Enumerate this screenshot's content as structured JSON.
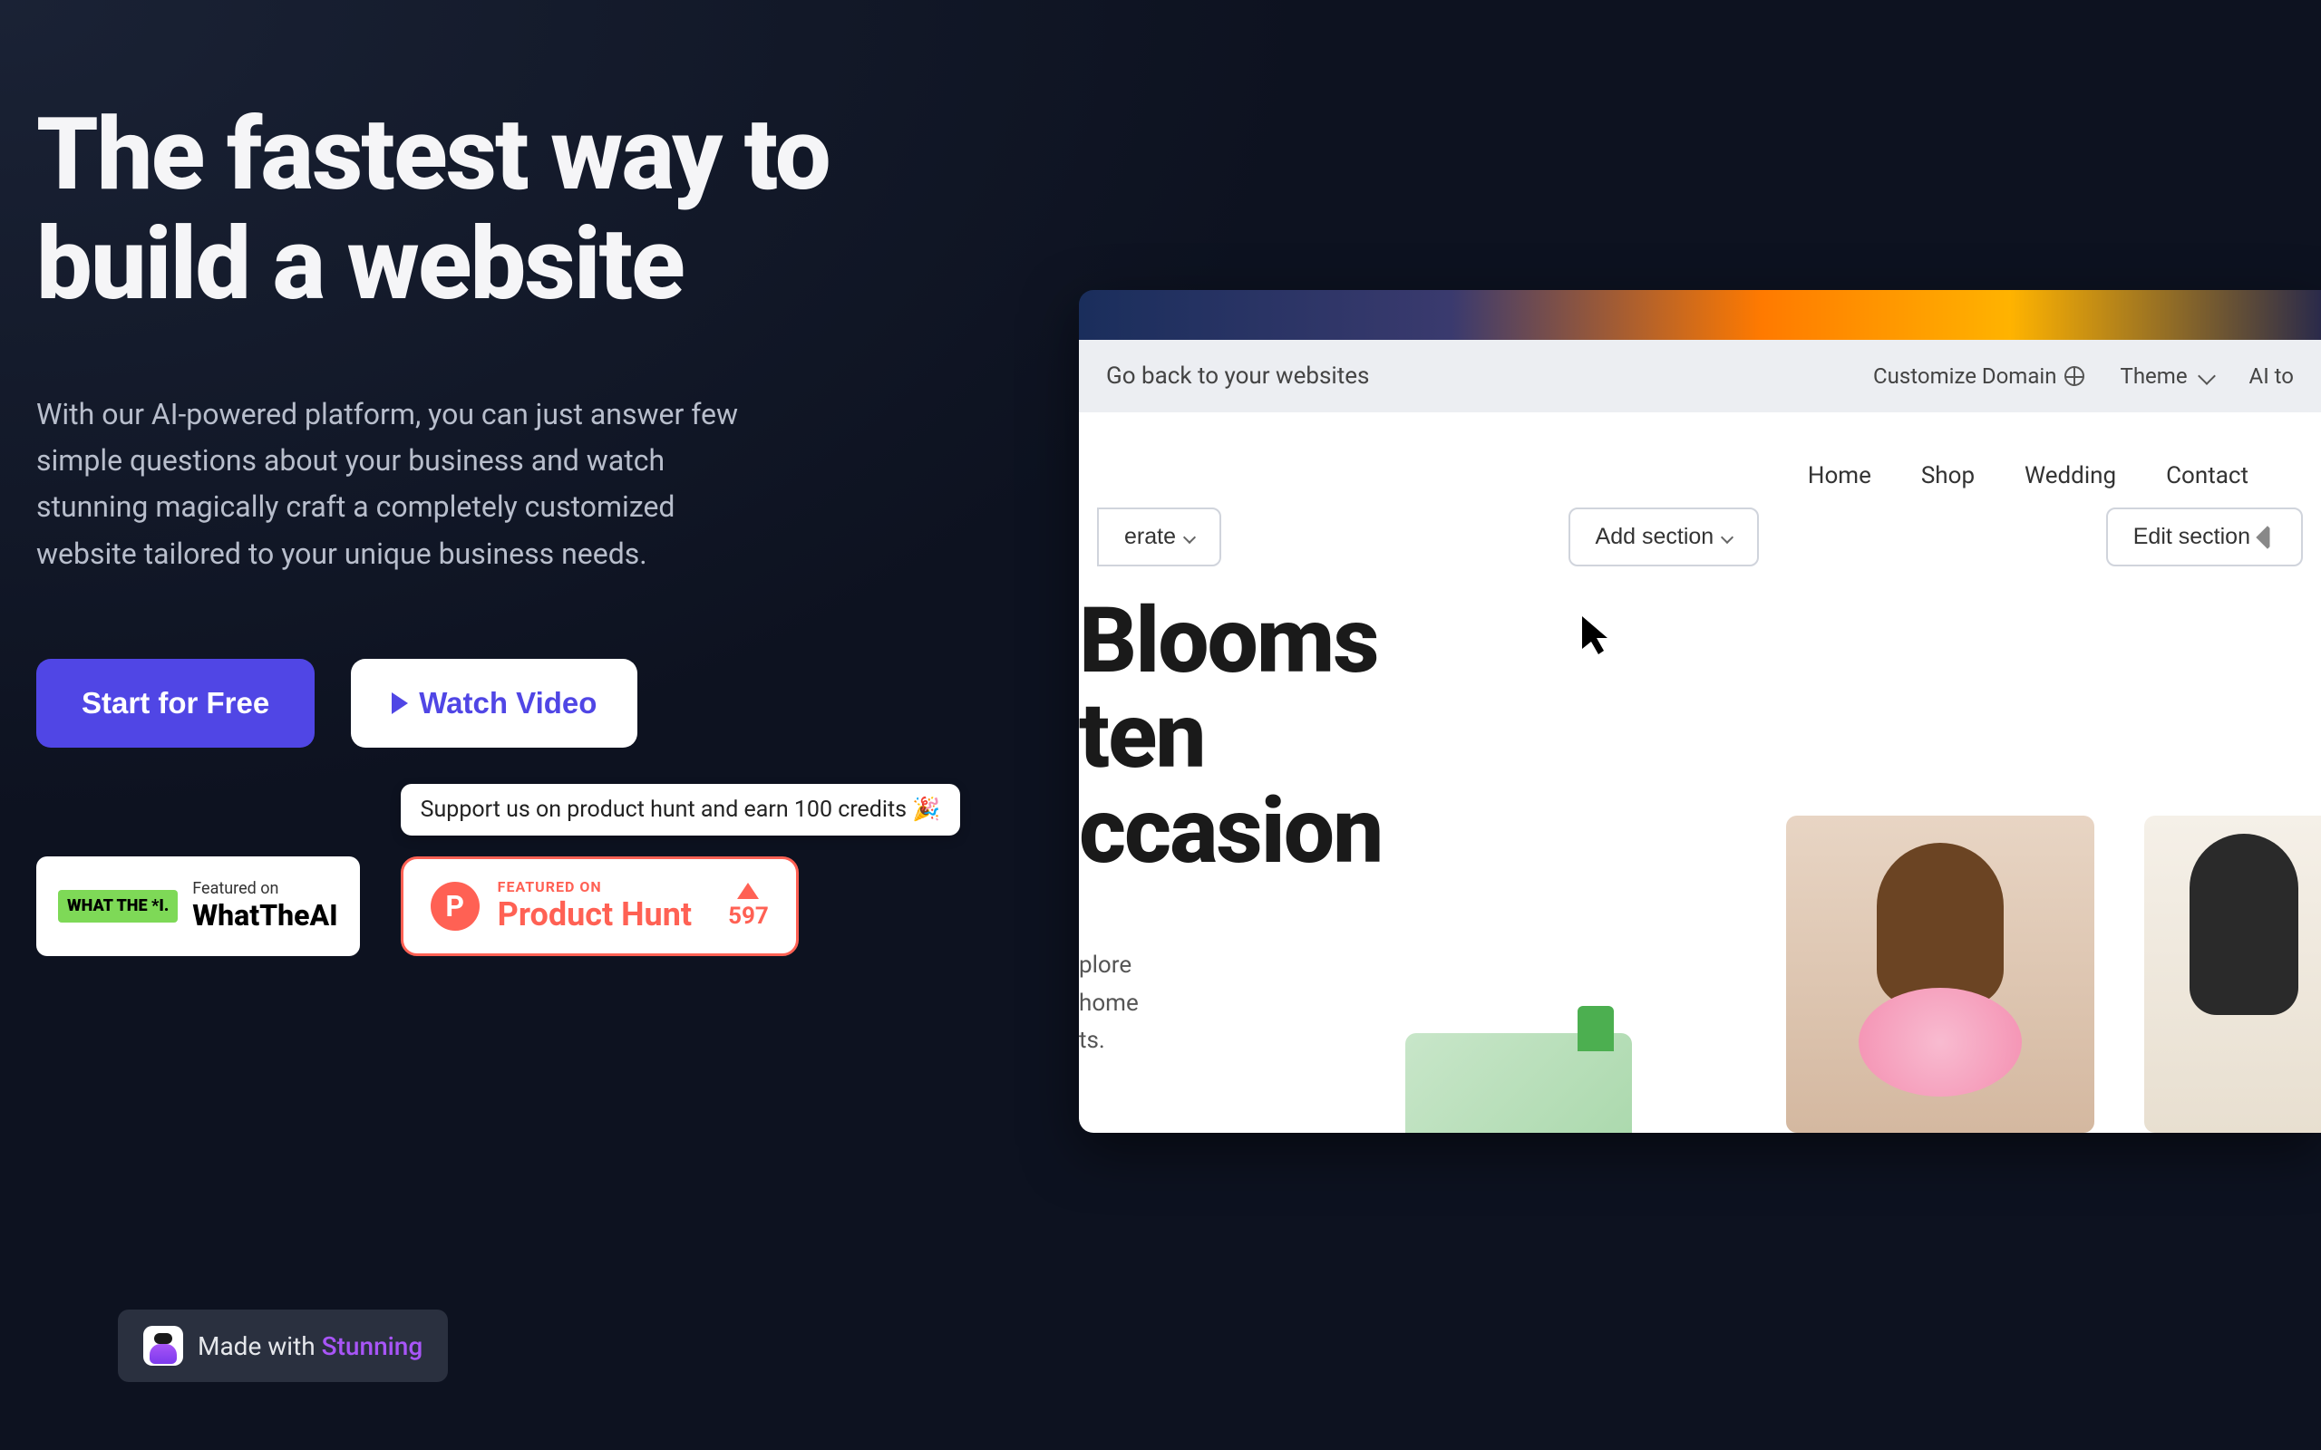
{
  "hero": {
    "title": "The fastest way to build a website",
    "subtitle": "With our AI-powered platform, you can just answer few simple questions about your business and watch stunning magically craft a completely customized website tailored to your unique business needs."
  },
  "cta": {
    "primary": "Start for Free",
    "secondary": "Watch Video"
  },
  "badges": {
    "wtai": {
      "logo_text": "WHAT THE *I.",
      "small": "Featured on",
      "big": "WhatTheAI"
    },
    "ph": {
      "tooltip": "Support us on product hunt and earn 100 credits 🎉",
      "letter": "P",
      "small": "FEATURED ON",
      "big": "Product Hunt",
      "votes": "597"
    }
  },
  "preview": {
    "toolbar": {
      "back": "Go back to your websites",
      "customize": "Customize Domain",
      "theme": "Theme",
      "ai": "AI to"
    },
    "nav": [
      "Home",
      "Shop",
      "Wedding",
      "Contact"
    ],
    "editor_buttons": {
      "regenerate": "erate",
      "add_section": "Add section",
      "edit_section": "Edit section"
    },
    "site": {
      "hero_line1": " Blooms",
      "hero_line2": "ten",
      "hero_line3": "ccasion",
      "sub_line1": "plore",
      "sub_line2": "home",
      "sub_line3": "ts."
    }
  },
  "made_with": {
    "prefix": "Made with ",
    "brand": "Stunning"
  }
}
